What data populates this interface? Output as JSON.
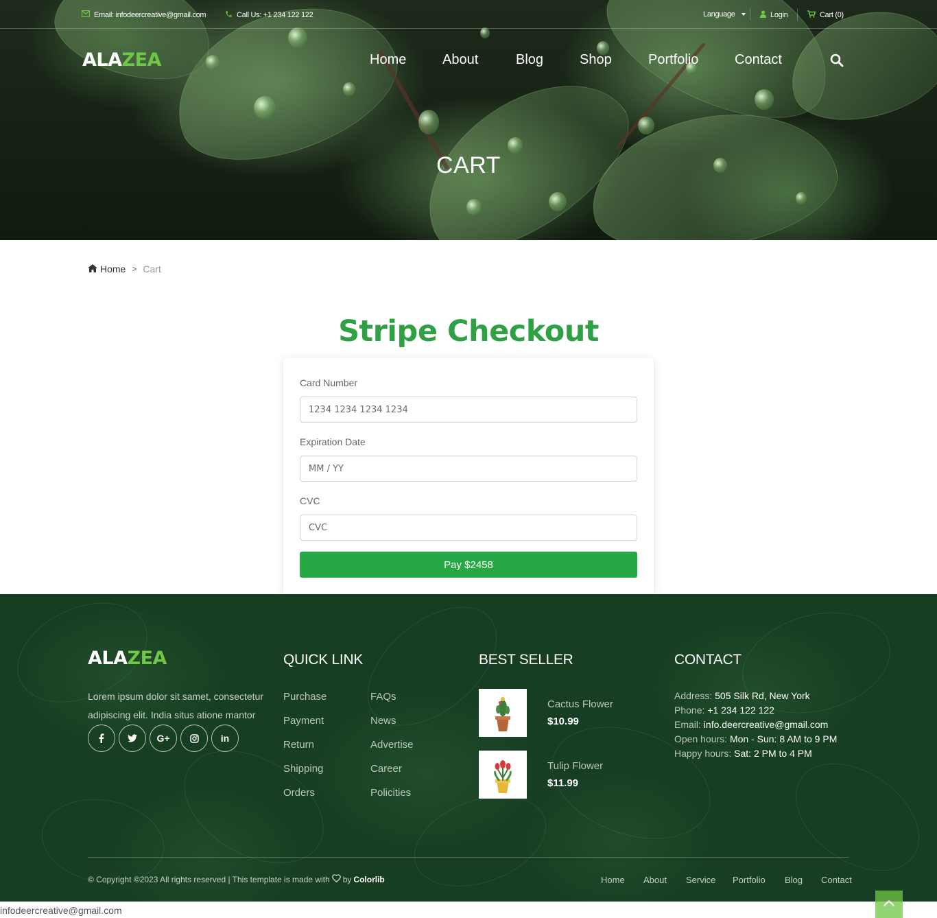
{
  "topbar": {
    "email": "Email: infodeercreative@gmail.com",
    "phone": "Call Us: +1 234 122 122",
    "language": "Language",
    "login": "Login",
    "cart": "Cart (0)"
  },
  "brand": {
    "prefix": "ALA",
    "accent": "ZEA"
  },
  "nav": [
    "Home",
    "About",
    "Blog",
    "Shop",
    "Portfolio",
    "Contact"
  ],
  "hero": {
    "title": "CART"
  },
  "breadcrumb": {
    "home": "Home",
    "separator": ">",
    "current": "Cart"
  },
  "checkout": {
    "title": "Stripe Checkout",
    "card_label": "Card Number",
    "card_placeholder": "1234 1234 1234 1234",
    "exp_label": "Expiration Date",
    "exp_placeholder": "MM / YY",
    "cvc_label": "CVC",
    "cvc_placeholder": "CVC",
    "pay_label": "Pay $2458"
  },
  "footer": {
    "about": "Lorem ipsum dolor sit samet, consectetur adipiscing elit. India situs atione mantor",
    "socials": [
      "f",
      "t",
      "G+",
      "ig",
      "in"
    ],
    "quick_link_title": "QUICK LINK",
    "quick_links_col1": [
      "Purchase",
      "Payment",
      "Return",
      "Shipping",
      "Orders"
    ],
    "quick_links_col2": [
      "FAQs",
      "News",
      "Advertise",
      "Career",
      "Policities"
    ],
    "best_seller_title": "BEST SELLER",
    "best_sellers": [
      {
        "name": "Cactus Flower",
        "price": "$10.99"
      },
      {
        "name": "Tulip Flower",
        "price": "$11.99"
      }
    ],
    "contact_title": "CONTACT",
    "contact": [
      {
        "label": "Address:",
        "value": "505 Silk Rd, New York"
      },
      {
        "label": "Phone:",
        "value": "+1 234 122 122"
      },
      {
        "label": "Email:",
        "value": "info.deercreative@gmail.com"
      },
      {
        "label": "Open hours:",
        "value": "Mon - Sun: 8 AM to 9 PM"
      },
      {
        "label": "Happy hours:",
        "value": "Sat: 2 PM to 4 PM"
      }
    ],
    "copyright_prefix": "© Copyright ©2023 All rights reserved | This template is made with",
    "copyright_by": "by",
    "copyright_brand": "Colorlib",
    "bottom_nav": [
      "Home",
      "About",
      "Service",
      "Portfolio",
      "Blog",
      "Contact"
    ]
  },
  "status_url": "infodeercreative@gmail.com",
  "colors": {
    "accent": "#70c745",
    "checkout_title": "#2fa043",
    "pay_button": "#28a745",
    "footer_bg": "#173d22"
  },
  "icons": [
    "envelope-icon",
    "phone-icon",
    "caret-down-icon",
    "user-icon",
    "cart-icon",
    "search-icon",
    "home-icon",
    "heart-icon",
    "chevron-up-icon"
  ]
}
